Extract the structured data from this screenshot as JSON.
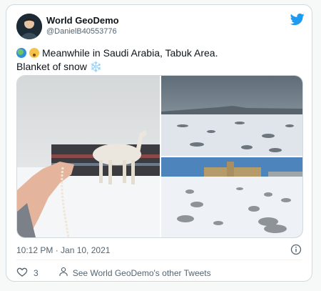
{
  "tweet": {
    "author_name": "World GeoDemo",
    "author_handle": "@DanielB40553776",
    "text_line1": "Meanwhile in Saudi Arabia, Tabuk Area.",
    "text_line2": "Blanket of snow",
    "snow_emoji": "❄️",
    "timestamp": "10:12 PM · Jan 10, 2021",
    "like_count": "3",
    "other_tweets_label": "See World GeoDemo's other Tweets"
  },
  "icons": {
    "bird": "twitter-bird-icon",
    "globe": "globe-emoji-icon",
    "face": "astonished-face-emoji-icon",
    "heart": "heart-icon",
    "person": "person-icon",
    "info": "info-icon"
  },
  "colors": {
    "brand": "#1d9bf0",
    "text_secondary": "#536471",
    "border": "#cfd9de"
  }
}
